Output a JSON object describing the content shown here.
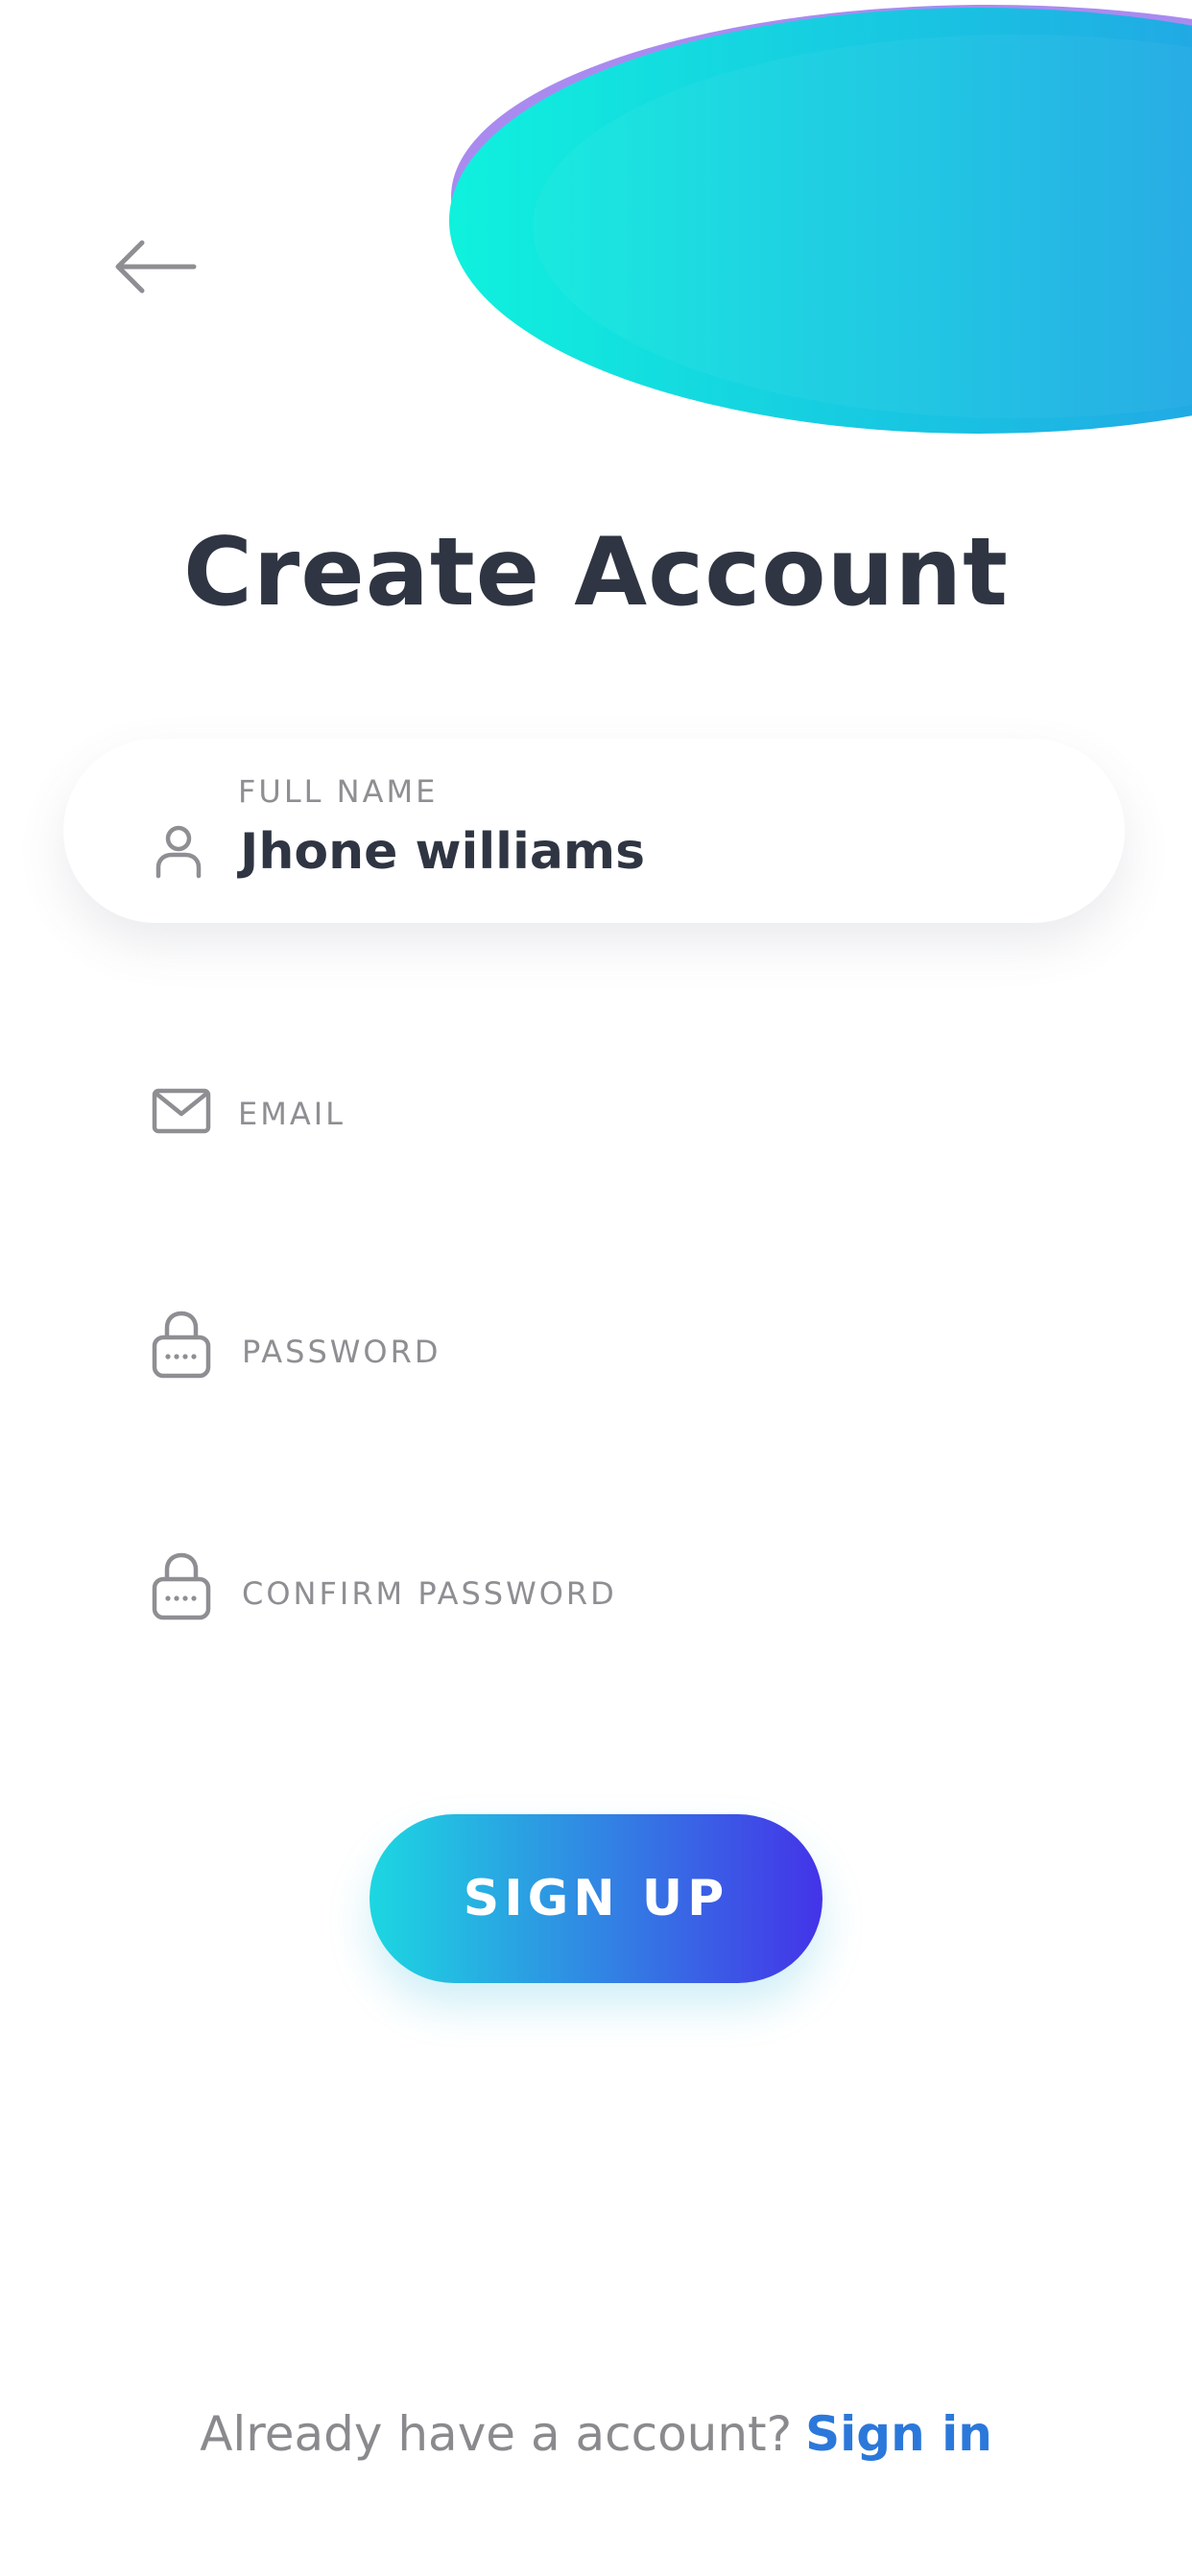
{
  "title": "Create Account",
  "fields": {
    "full_name": {
      "label": "FULL NAME",
      "value": "Jhone williams",
      "icon": "user-icon"
    },
    "email": {
      "label": "EMAIL",
      "icon": "mail-icon"
    },
    "password": {
      "label": "PASSWORD",
      "icon": "lock-icon"
    },
    "confirm_password": {
      "label": "CONFIRM PASSWORD",
      "icon": "lock-icon"
    }
  },
  "signup_button": {
    "label": "SIGN UP"
  },
  "footer": {
    "prompt": "Already have a account?",
    "link": "Sign in"
  },
  "colors": {
    "title": "#2f3542",
    "accent": "#2b78db",
    "gradient_start": "#1cd7e1",
    "gradient_end": "#4433e8",
    "blob_purple": "#a98bf0",
    "muted": "#8e8e93"
  },
  "icons": {
    "back": "arrow-left-icon"
  }
}
